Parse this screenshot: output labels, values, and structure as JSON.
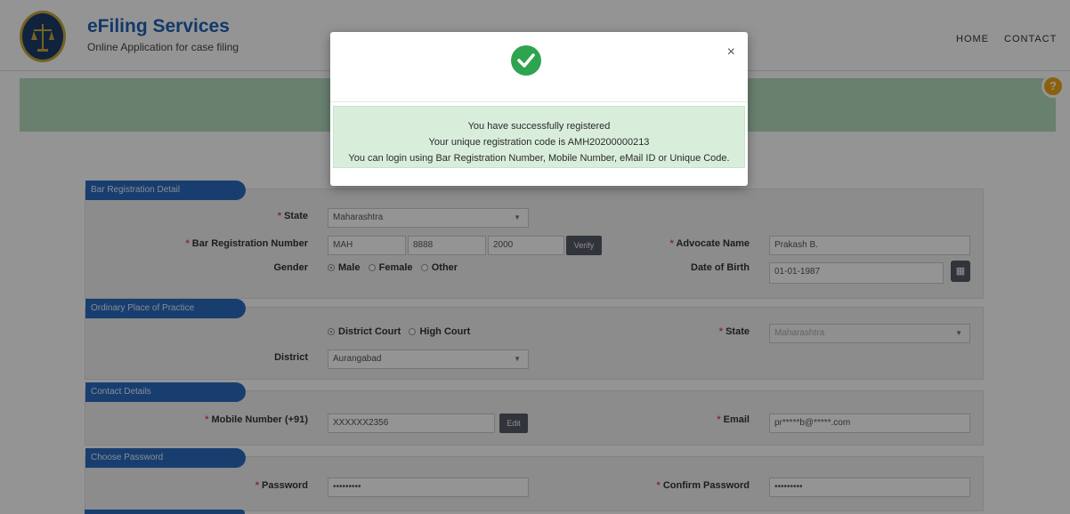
{
  "header": {
    "title": "eFiling Services",
    "subtitle": "Online Application for case filing",
    "nav": {
      "home": "HOME",
      "contact": "CONTACT"
    }
  },
  "help_badge": "?",
  "sections": {
    "bar": {
      "title": "Bar Registration Detail",
      "state_label": "State",
      "state_value": "Maharashtra",
      "bar_reg_label": "Bar Registration Number",
      "bar_reg_part1": "MAH",
      "bar_reg_part2": "8888",
      "bar_reg_part3": "2000",
      "verify": "Verify",
      "advocate_label": "Advocate Name",
      "advocate_value": "Prakash B.",
      "gender_label": "Gender",
      "gender_options": [
        "Male",
        "Female",
        "Other"
      ],
      "gender_selected": "Male",
      "dob_label": "Date of Birth",
      "dob_value": "01-01-1987"
    },
    "practice": {
      "title": "Ordinary Place of Practice",
      "court_options": [
        "District Court",
        "High Court"
      ],
      "court_selected": "District Court",
      "state_label": "State",
      "state_value": "Maharashtra",
      "district_label": "District",
      "district_value": "Aurangabad"
    },
    "contact": {
      "title": "Contact Details",
      "mobile_label": "Mobile Number (+91)",
      "mobile_value": "XXXXXX2356",
      "edit": "Edit",
      "email_label": "Email",
      "email_value": "pr*****b@*****.com"
    },
    "password": {
      "title": "Choose Password",
      "password_label": "Password",
      "password_value": "•••••••••",
      "confirm_label": "Confirm Password",
      "confirm_value": "•••••••••"
    }
  },
  "modal": {
    "close": "×",
    "line1": "You have successfully registered",
    "line2": "Your unique registration code is AMH20200000213",
    "line3": "You can login using Bar Registration Number, Mobile Number, eMail ID or Unique Code."
  },
  "colors": {
    "brand": "#1f62b7",
    "success": "#2ea44f",
    "alert_bg": "#d8eedb",
    "section_head": "#2a6cc1"
  }
}
